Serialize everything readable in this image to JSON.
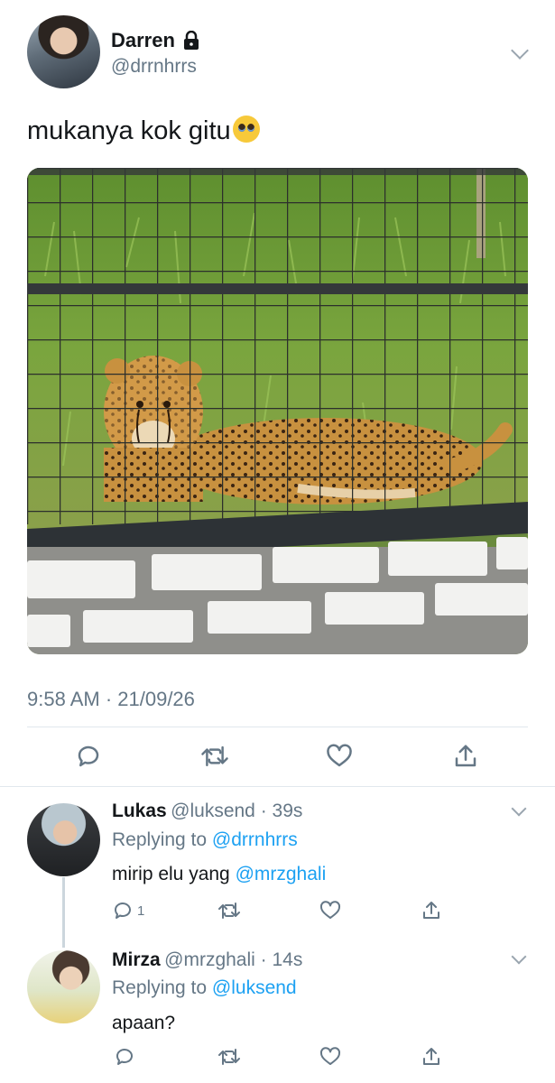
{
  "tweet": {
    "display_name": "Darren",
    "handle": "@drrnhrrs",
    "text": "mukanya kok gitu",
    "emoji": "pleading-face-emoji",
    "timestamp": "9:58 AM · 21/09/26"
  },
  "replies": [
    {
      "name": "Lukas",
      "handle": "@luksend",
      "time_sep": " · ",
      "time": "39s",
      "replying_prefix": "Replying to ",
      "replying_to": "@drrnhrrs",
      "text_prefix": "mirip elu yang ",
      "mention": "@mrzghali",
      "reply_count": "1"
    },
    {
      "name": "Mirza",
      "handle": "@mrzghali",
      "time_sep": " · ",
      "time": "14s",
      "replying_prefix": "Replying to ",
      "replying_to": "@luksend",
      "text": "apaan?"
    }
  ],
  "colors": {
    "link": "#1da1f2",
    "secondary_text": "#657786",
    "primary_text": "#14171a",
    "divider": "#e1e8ed"
  },
  "icons": [
    "lock-icon",
    "chevron-down-icon",
    "reply-icon",
    "retweet-icon",
    "like-icon",
    "share-icon"
  ]
}
